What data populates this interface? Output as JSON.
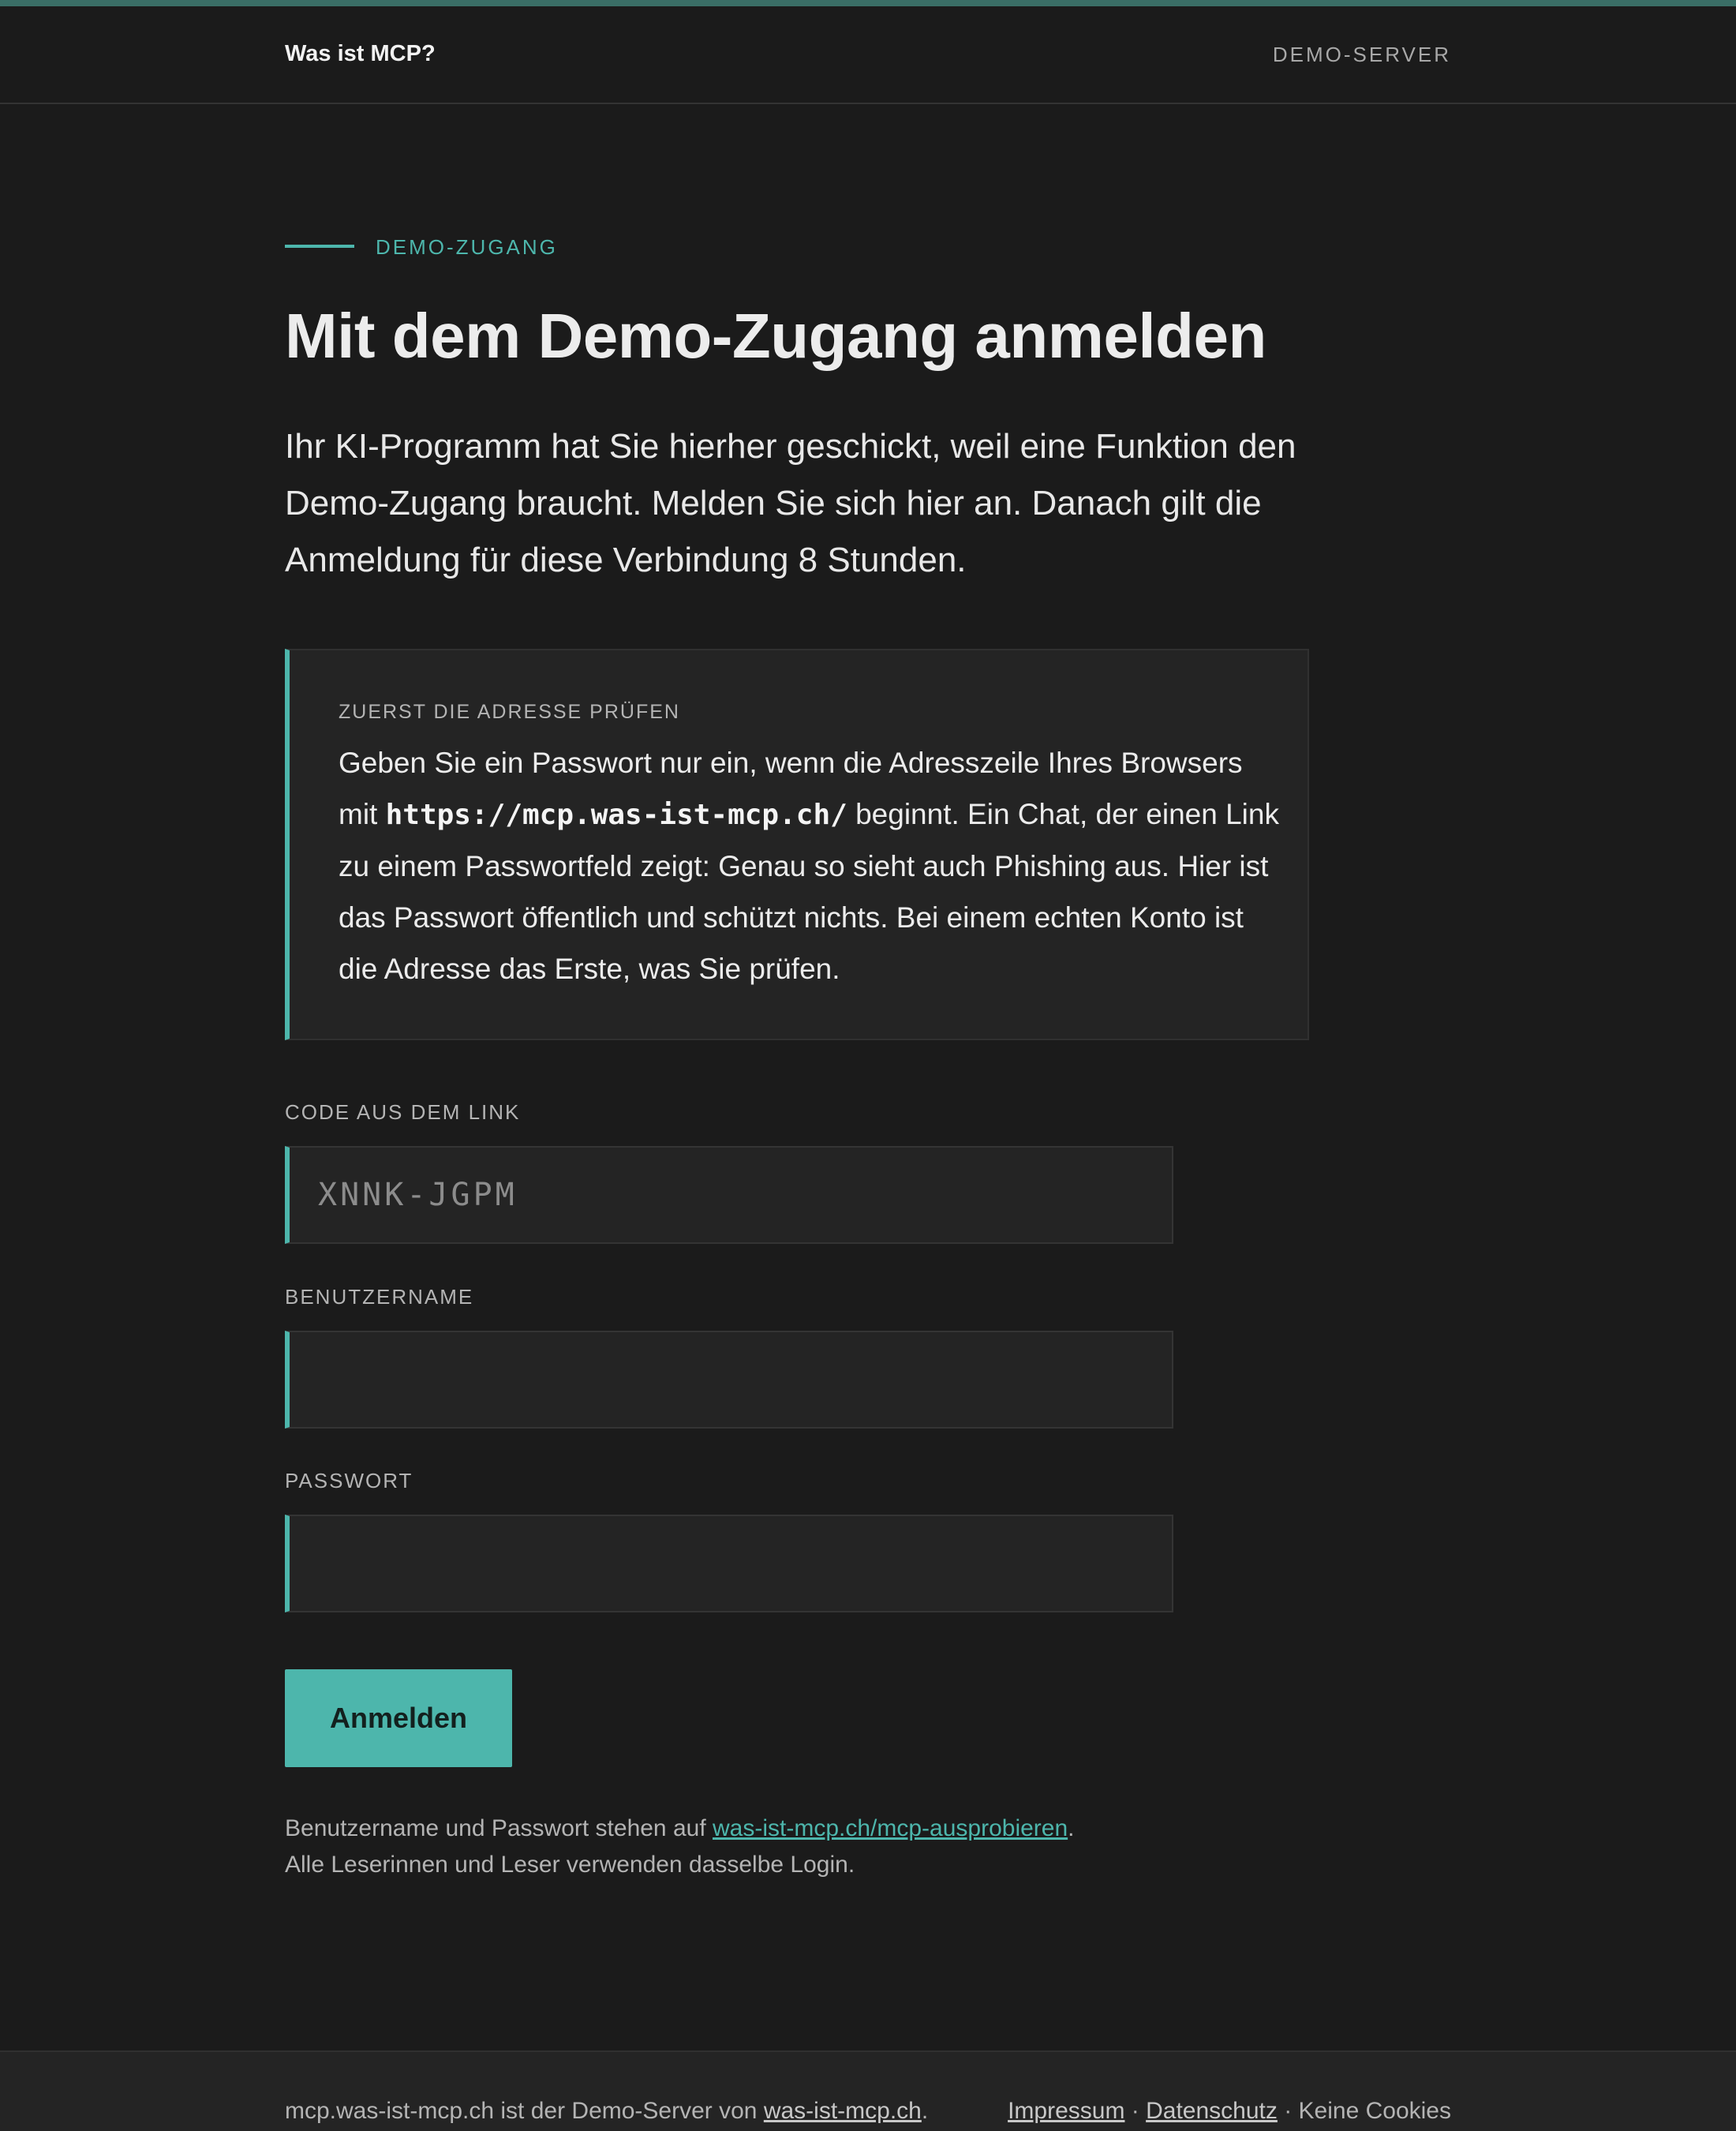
{
  "colors": {
    "background": "#1b1b1b",
    "accent": "#4db6ac",
    "panel": "#242424",
    "text": "#e6e6e6",
    "muted": "#b4b4b4"
  },
  "header": {
    "brand": "Was ist MCP?",
    "server_tag": "DEMO-SERVER"
  },
  "main": {
    "eyebrow": "DEMO-ZUGANG",
    "title": "Mit dem Demo-Zugang anmelden",
    "lead": "Ihr KI-Programm hat Sie hierher geschickt, weil eine Funktion den Demo-Zugang braucht. Melden Sie sich hier an. Danach gilt die Anmeldung für diese Verbindung 8 Stunden."
  },
  "notice": {
    "title": "ZUERST DIE ADRESSE PRÜFEN",
    "text_before": "Geben Sie ein Passwort nur ein, wenn die Adresszeile Ihres Browsers mit ",
    "url": "https://mcp.was-ist-mcp.ch/",
    "text_after": " beginnt. Ein Chat, der einen Link zu einem Passwortfeld zeigt: Genau so sieht auch Phishing aus. Hier ist das Passwort öffentlich und schützt nichts. Bei einem echten Konto ist die Adresse das Erste, was Sie prüfen."
  },
  "form": {
    "code_label": "CODE AUS DEM LINK",
    "code_placeholder": "XNNK-JGPM",
    "code_value": "",
    "username_label": "BENUTZERNAME",
    "username_value": "",
    "password_label": "PASSWORT",
    "password_value": "",
    "submit_label": "Anmelden"
  },
  "hint": {
    "line1_before": "Benutzername und Passwort stehen auf ",
    "line1_link": "was-ist-mcp.ch/mcp-ausprobieren",
    "line1_after": ".",
    "line2": "Alle Leserinnen und Leser verwenden dasselbe Login."
  },
  "footer": {
    "left_before": "mcp.was-ist-mcp.ch ist der Demo-Server von ",
    "left_link": "was-ist-mcp.ch",
    "left_after": ".",
    "impressum": "Impressum",
    "separator": " · ",
    "datenschutz": "Datenschutz",
    "no_cookies": "Keine Cookies"
  }
}
